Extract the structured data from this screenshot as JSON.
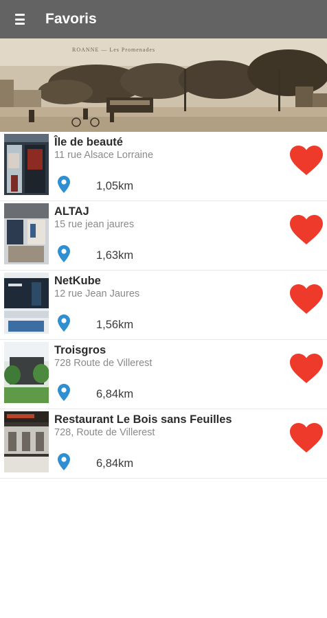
{
  "appbar": {
    "title": "Favoris",
    "menu_icon": "hamburger-menu-icon"
  },
  "banner": {
    "caption": "ROANNE — Les Promenades"
  },
  "colors": {
    "appbar": "#636363",
    "heart": "#ee3a2b",
    "pin": "#2f8fd1"
  },
  "favorites": [
    {
      "name": "Île de beauté",
      "address": "11 rue Alsace Lorraine",
      "distance": "1,05km"
    },
    {
      "name": "ALTAJ",
      "address": "15 rue jean jaures",
      "distance": "1,63km"
    },
    {
      "name": "NetKube",
      "address": "12 rue Jean Jaures",
      "distance": "1,56km"
    },
    {
      "name": "Troisgros",
      "address": "728 Route de Villerest",
      "distance": "6,84km"
    },
    {
      "name": "Restaurant Le Bois sans Feuilles",
      "address": "728, Route de Villerest",
      "distance": "6,84km"
    }
  ]
}
